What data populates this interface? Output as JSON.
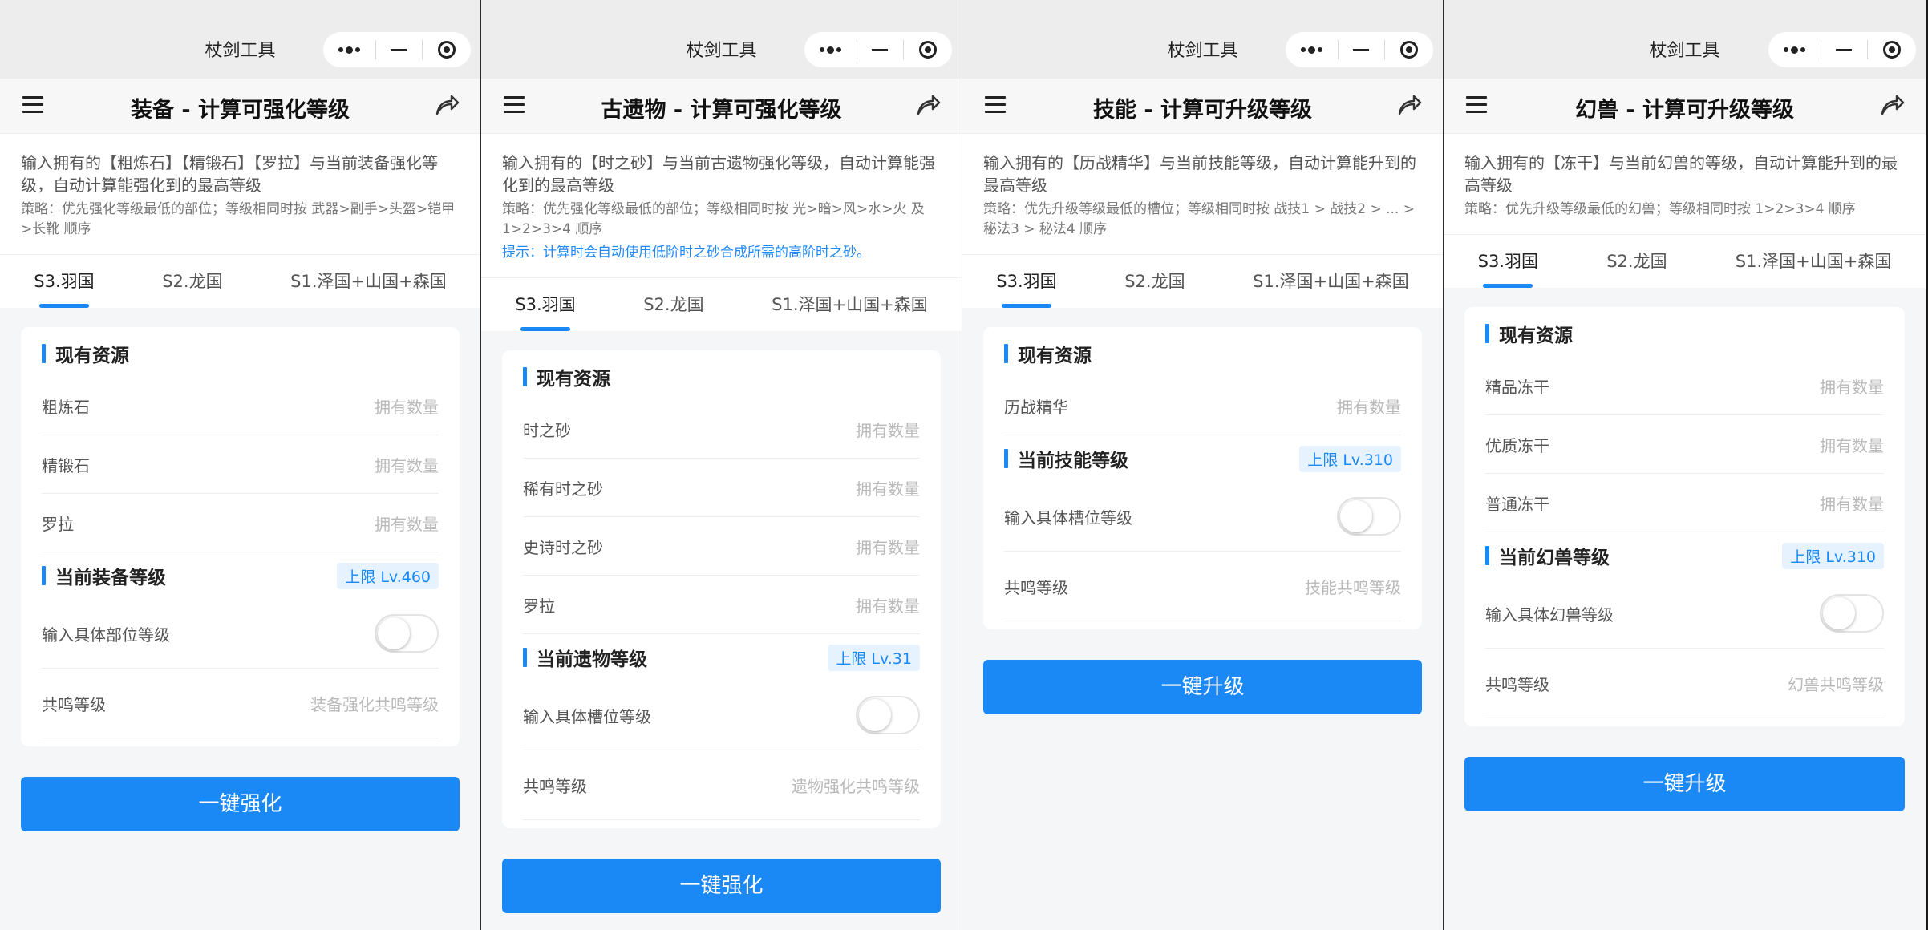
{
  "app_title": "杖剑工具",
  "tabs": [
    "S3.羽国",
    "S2.龙国",
    "S1.泽国+山国+森国"
  ],
  "phones": [
    {
      "nav_title": "装备 - 计算可强化等级",
      "desc": "输入拥有的【粗炼石】【精锻石】【罗拉】与当前装备强化等级，自动计算能强化到的最高等级",
      "strategy": "策略：优先强化等级最低的部位；等级相同时按 武器>副手>头盔>铠甲>长靴 顺序",
      "resources_title": "现有资源",
      "resources": [
        {
          "label": "粗炼石",
          "placeholder": "拥有数量"
        },
        {
          "label": "精锻石",
          "placeholder": "拥有数量"
        },
        {
          "label": "罗拉",
          "placeholder": "拥有数量"
        }
      ],
      "level_title": "当前装备等级",
      "level_badge": "上限 Lv.460",
      "toggle_label": "输入具体部位等级",
      "resonance_label": "共鸣等级",
      "resonance_placeholder": "装备强化共鸣等级",
      "button": "一键强化"
    },
    {
      "nav_title": "古遗物 - 计算可强化等级",
      "desc": "输入拥有的【时之砂】与当前古遗物强化等级，自动计算能强化到的最高等级",
      "strategy": "策略：优先强化等级最低的部位；等级相同时按 光>暗>风>水>火 及 1>2>3>4 顺序",
      "tip": "提示：计算时会自动使用低阶时之砂合成所需的高阶时之砂。",
      "resources_title": "现有资源",
      "resources": [
        {
          "label": "时之砂",
          "placeholder": "拥有数量"
        },
        {
          "label": "稀有时之砂",
          "placeholder": "拥有数量"
        },
        {
          "label": "史诗时之砂",
          "placeholder": "拥有数量"
        },
        {
          "label": "罗拉",
          "placeholder": "拥有数量"
        }
      ],
      "level_title": "当前遗物等级",
      "level_badge": "上限 Lv.31",
      "toggle_label": "输入具体槽位等级",
      "resonance_label": "共鸣等级",
      "resonance_placeholder": "遗物强化共鸣等级",
      "button": "一键强化"
    },
    {
      "nav_title": "技能 - 计算可升级等级",
      "desc": "输入拥有的【历战精华】与当前技能等级，自动计算能升到的最高等级",
      "strategy": "策略：优先升级等级最低的槽位；等级相同时按 战技1 > 战技2 > ... > 秘法3 > 秘法4 顺序",
      "resources_title": "现有资源",
      "resources": [
        {
          "label": "历战精华",
          "placeholder": "拥有数量"
        }
      ],
      "level_title": "当前技能等级",
      "level_badge": "上限 Lv.310",
      "toggle_label": "输入具体槽位等级",
      "resonance_label": "共鸣等级",
      "resonance_placeholder": "技能共鸣等级",
      "button": "一键升级"
    },
    {
      "nav_title": "幻兽 - 计算可升级等级",
      "desc": "输入拥有的【冻干】与当前幻兽的等级，自动计算能升到的最高等级",
      "strategy": "策略：优先升级等级最低的幻兽；等级相同时按 1>2>3>4 顺序",
      "resources_title": "现有资源",
      "resources": [
        {
          "label": "精品冻干",
          "placeholder": "拥有数量"
        },
        {
          "label": "优质冻干",
          "placeholder": "拥有数量"
        },
        {
          "label": "普通冻干",
          "placeholder": "拥有数量"
        }
      ],
      "level_title": "当前幻兽等级",
      "level_badge": "上限 Lv.310",
      "toggle_label": "输入具体幻兽等级",
      "resonance_label": "共鸣等级",
      "resonance_placeholder": "幻兽共鸣等级",
      "button": "一键升级"
    }
  ],
  "colors": {
    "accent": "#1a88f5",
    "badge_bg": "#e6f3ff",
    "page_bg": "#f5f6f8"
  }
}
